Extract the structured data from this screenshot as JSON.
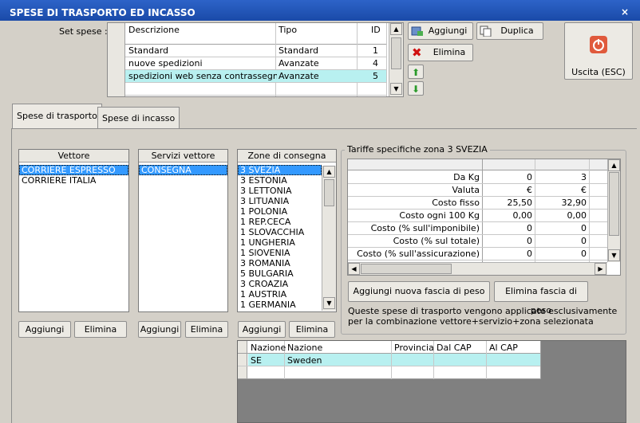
{
  "window": {
    "title": "SPESE DI TRASPORTO ED INCASSO",
    "close_glyph": "×"
  },
  "set_spese": {
    "label": "Set spese :",
    "columns": [
      "Descrizione",
      "Tipo",
      "ID"
    ],
    "rows": [
      {
        "descrizione": "Standard",
        "tipo": "Standard",
        "id": "1"
      },
      {
        "descrizione": "nuove spedizioni",
        "tipo": "Avanzate",
        "id": "4"
      },
      {
        "descrizione": "spedizioni web senza contrassegno…",
        "tipo": "Avanzate",
        "id": "5"
      }
    ]
  },
  "toolbar": {
    "aggiungi": "Aggiungi",
    "duplica": "Duplica",
    "elimina": "Elimina",
    "uscita": "Uscita (ESC)"
  },
  "tabs": {
    "trasporto": "Spese di trasporto",
    "incasso": "Spese di incasso"
  },
  "vettore": {
    "header": "Vettore",
    "items": [
      "CORRIERE ESPRESSO",
      "CORRIERE ITALIA"
    ]
  },
  "servizi": {
    "header": "Servizi vettore",
    "items": [
      "CONSEGNA"
    ]
  },
  "zone": {
    "header": "Zone di consegna",
    "items": [
      "3 SVEZIA",
      "3 ESTONIA",
      "3 LETTONIA",
      "3 LITUANIA",
      "1 POLONIA",
      "1 REP.CECA",
      "1 SLOVACCHIA",
      "1 UNGHERIA",
      "1 SlOVENIA",
      "3 ROMANIA",
      "5 BULGARIA",
      "3 CROAZIA",
      "1 AUSTRIA",
      "1 GERMANIA"
    ]
  },
  "list_buttons": {
    "aggiungi": "Aggiungi",
    "elimina": "Elimina"
  },
  "tariffe": {
    "title": "Tariffe specifiche zona 3 SVEZIA",
    "rows": [
      {
        "label": "Da Kg",
        "v1": "0",
        "v2": "3"
      },
      {
        "label": "Valuta",
        "v1": "€",
        "v2": "€"
      },
      {
        "label": "Costo fisso",
        "v1": "25,50",
        "v2": "32,90"
      },
      {
        "label": "Costo ogni 100 Kg",
        "v1": "0,00",
        "v2": "0,00"
      },
      {
        "label": "Costo (% sull'imponibile)",
        "v1": "0",
        "v2": "0"
      },
      {
        "label": "Costo (% sul totale)",
        "v1": "0",
        "v2": "0"
      },
      {
        "label": "Costo (% sull'assicurazione)",
        "v1": "0",
        "v2": "0"
      }
    ],
    "btn_aggiungi_fascia": "Aggiungi nuova fascia di peso",
    "btn_elimina_fascia": "Elimina fascia di peso",
    "note": "Queste spese di trasporto vengono applicate esclusivamente per la combinazione vettore+servizio+zona selezionata"
  },
  "nazioni": {
    "columns": [
      "Nazione",
      "Nazione",
      "Provincia",
      "Dal CAP",
      "Al CAP"
    ],
    "rows": [
      {
        "code": "SE",
        "name": "Sweden",
        "provincia": "",
        "dal": "",
        "al": ""
      }
    ]
  },
  "colors": {
    "titlebar": "#1f52b4",
    "selection": "#3399ff",
    "row_highlight": "#b8f0f0"
  }
}
